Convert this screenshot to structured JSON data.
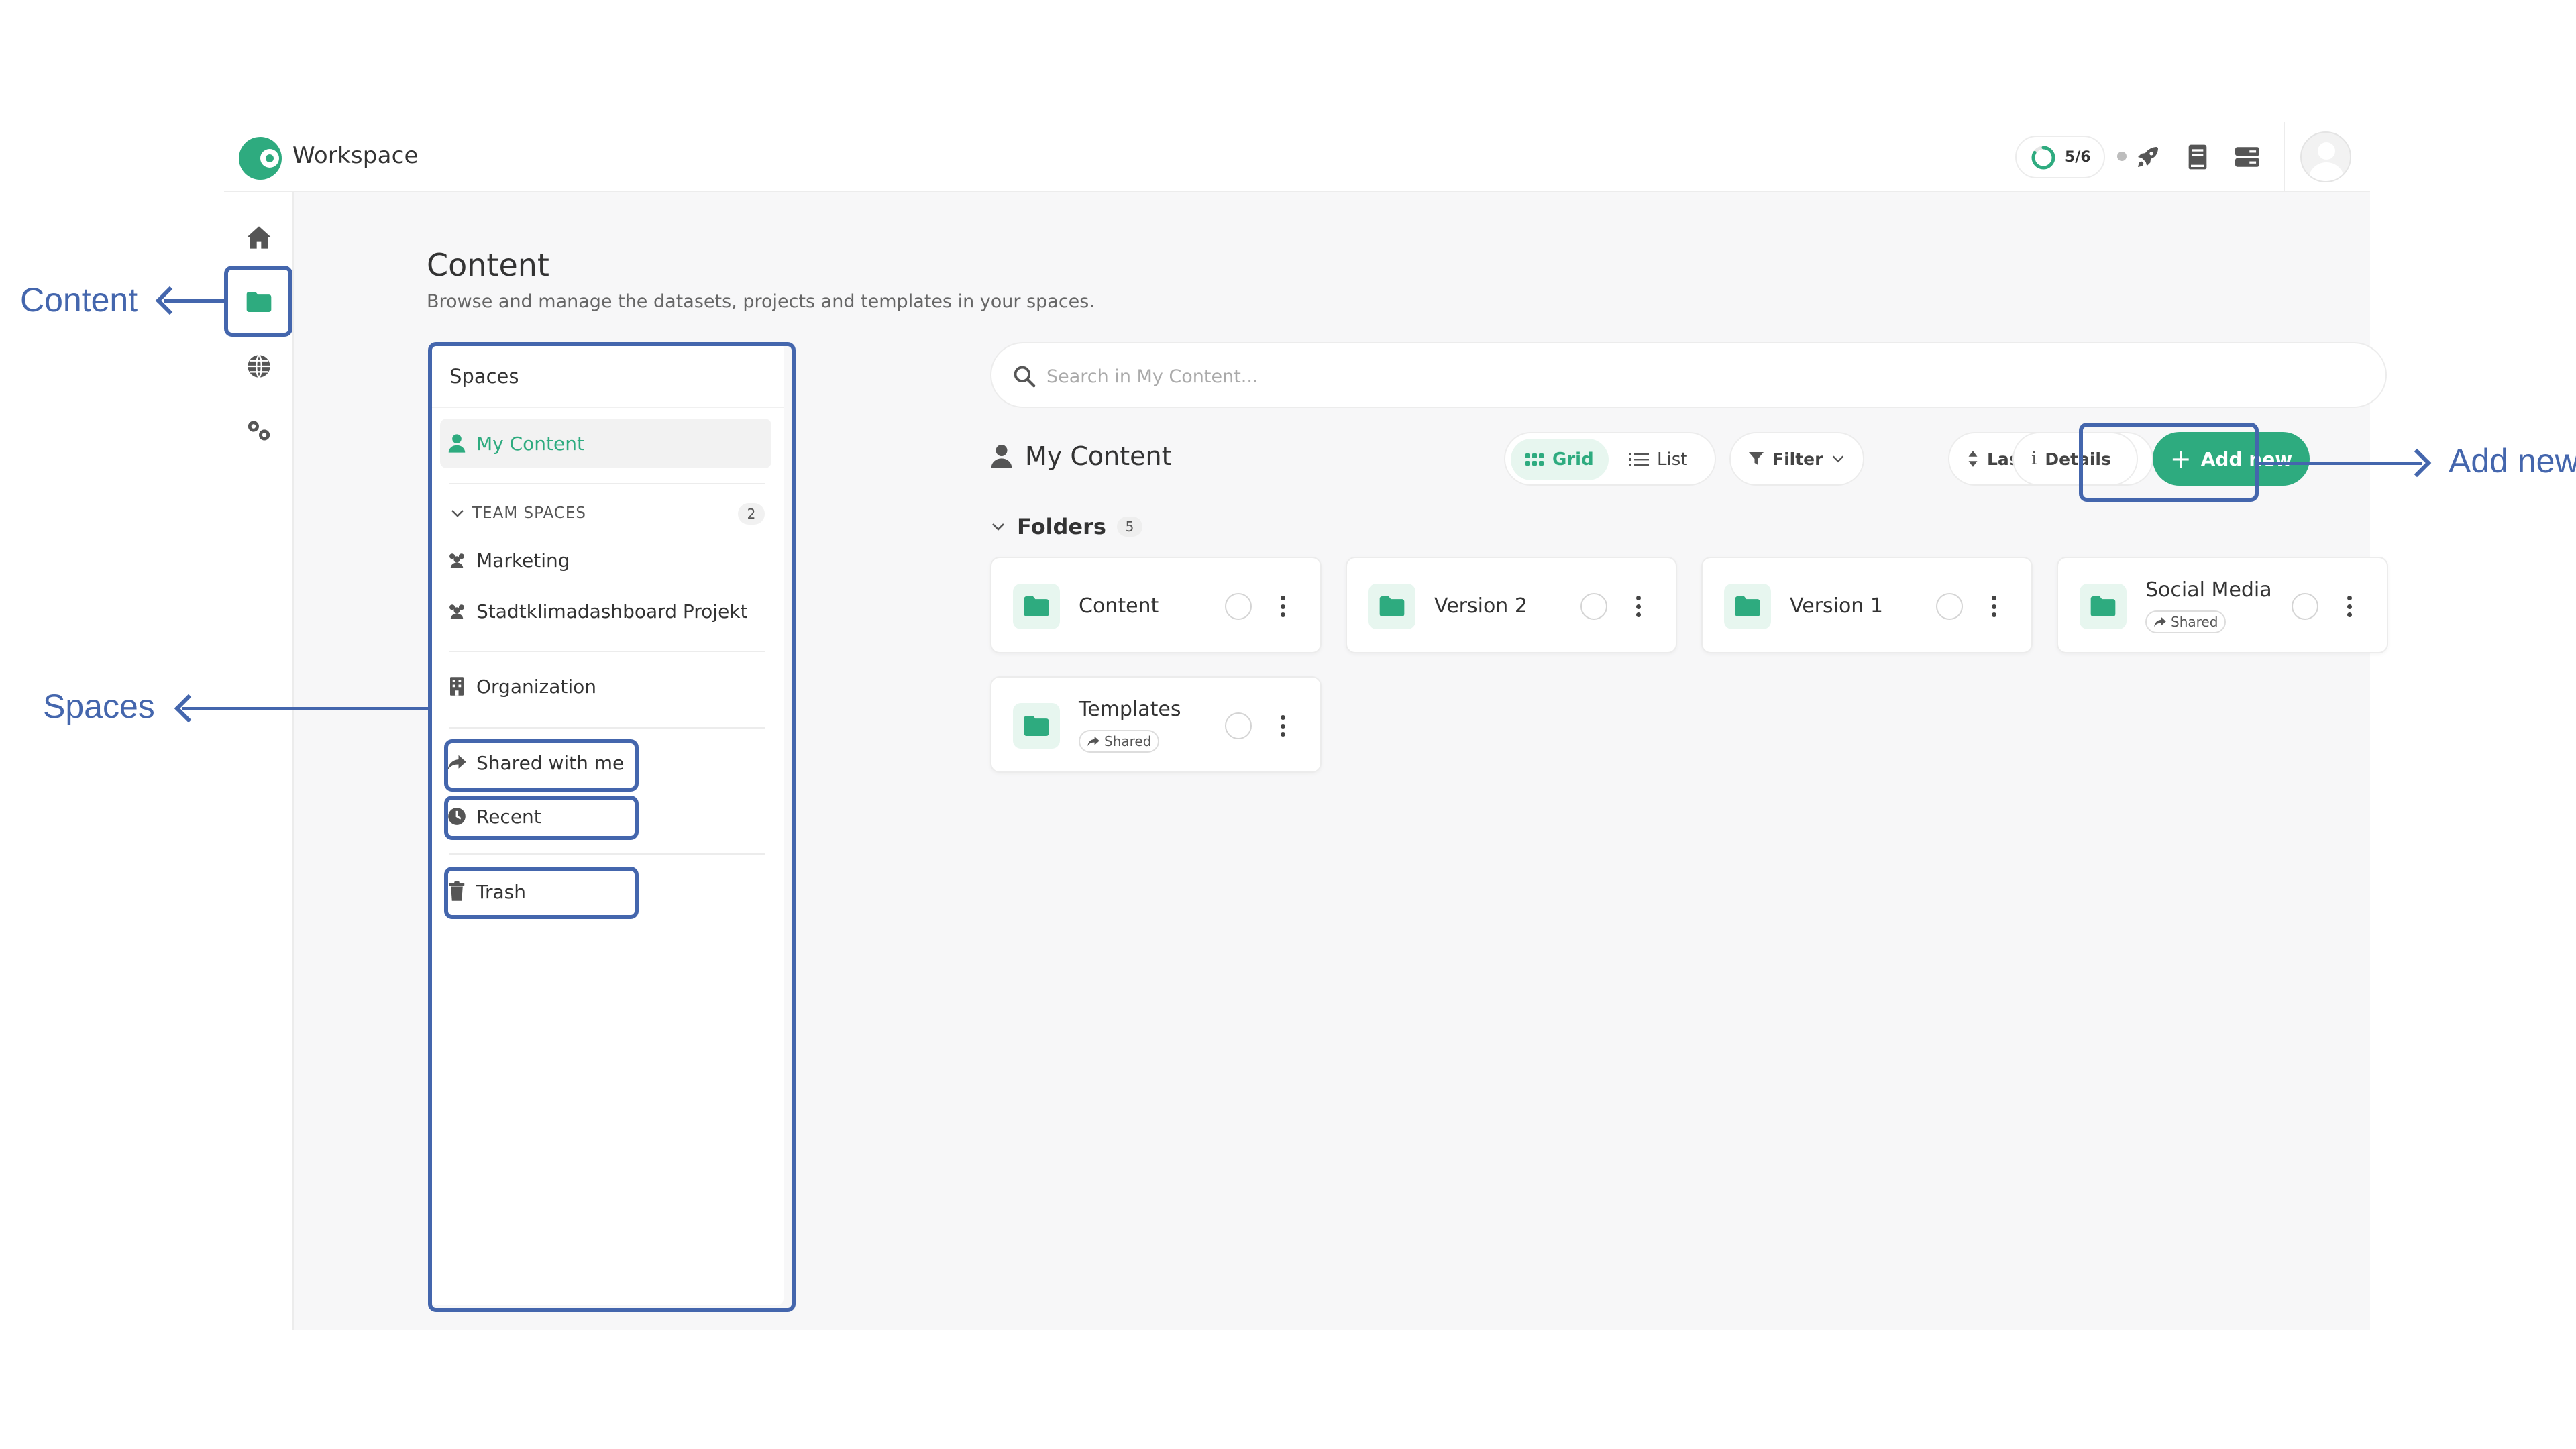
{
  "app": {
    "title": "Workspace",
    "progress_text": "5/6",
    "progress_fraction": 0.833,
    "accent_color": "#2eab7f",
    "top_icons": [
      "rocket-icon",
      "book-icon",
      "server-icon"
    ],
    "rail_icons": [
      "home-icon",
      "folder-icon",
      "globe-icon",
      "gears-icon"
    ]
  },
  "page": {
    "title": "Content",
    "subtitle": "Browse and manage the datasets, projects and templates in your spaces."
  },
  "spaces": {
    "heading": "Spaces",
    "my_content": "My Content",
    "team_spaces_label": "TEAM SPACES",
    "team_spaces_count": "2",
    "team_spaces": [
      "Marketing",
      "Stadtklimadashboard Projekt"
    ],
    "organization": "Organization",
    "shared_with_me": "Shared with me",
    "recent": "Recent",
    "trash": "Trash"
  },
  "content": {
    "search_placeholder": "Search in My Content...",
    "section_title": "My Content",
    "view_grid": "Grid",
    "view_list": "List",
    "filter": "Filter",
    "sort": "Last updated",
    "details": "Details",
    "add_new": "Add new",
    "folders_label": "Folders",
    "folders_count": "5",
    "folders": [
      {
        "name": "Content",
        "badge": ""
      },
      {
        "name": "Version 2",
        "badge": ""
      },
      {
        "name": "Version 1",
        "badge": ""
      },
      {
        "name": "Social Media",
        "badge": "Shared"
      },
      {
        "name": "Templates",
        "badge": "Shared"
      }
    ]
  },
  "annotations": {
    "content": "Content",
    "spaces": "Spaces",
    "add_new": "Add new",
    "color": "#4466ad"
  }
}
